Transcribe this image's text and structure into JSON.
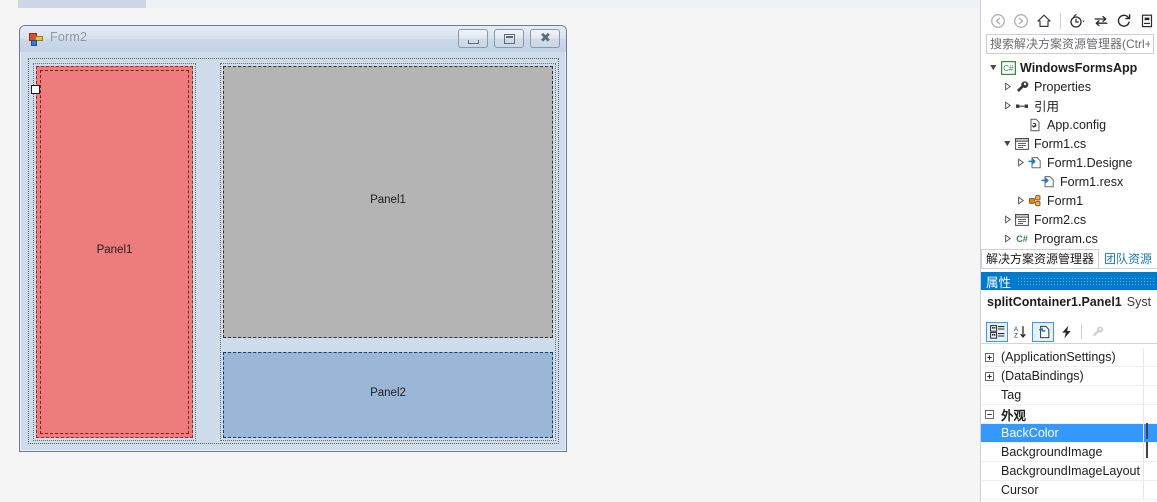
{
  "designer": {
    "form": {
      "title": "Form2",
      "icon": "form-icon",
      "window_buttons": [
        {
          "name": "minimize-button",
          "glyph": "minimize"
        },
        {
          "name": "maximize-button",
          "glyph": "maximize"
        },
        {
          "name": "close-button",
          "glyph": "close"
        }
      ]
    },
    "panels": [
      {
        "name": "panel-red",
        "label": "Panel1",
        "color": "#ee7c7c"
      },
      {
        "name": "panel-gray",
        "label": "Panel1",
        "color": "#b4b4b4"
      },
      {
        "name": "panel-blue",
        "label": "Panel2",
        "color": "#9bb7d8"
      }
    ]
  },
  "solution_explorer": {
    "toolbar": [
      {
        "name": "back-icon",
        "label": "Back"
      },
      {
        "name": "forward-icon",
        "label": "Forward"
      },
      {
        "name": "home-icon",
        "label": "Home"
      },
      {
        "name": "pending-changes-icon",
        "label": "Pending Changes"
      },
      {
        "name": "sync-with-active-document-icon",
        "label": "Sync with Active Document"
      },
      {
        "name": "refresh-icon",
        "label": "Refresh"
      },
      {
        "name": "collapse-all-icon",
        "label": "Collapse All"
      }
    ],
    "search": {
      "placeholder": "搜索解决方案资源管理器(Ctrl+;",
      "value": ""
    },
    "tree": [
      {
        "label": "WindowsFormsApp",
        "indent": 0,
        "expander": "down",
        "icon": "csharp-project-icon",
        "bold": true
      },
      {
        "label": "Properties",
        "indent": 1,
        "expander": "right",
        "icon": "properties-wrench-icon",
        "bold": false
      },
      {
        "label": "引用",
        "indent": 1,
        "expander": "right",
        "icon": "references-icon",
        "bold": false
      },
      {
        "label": "App.config",
        "indent": 2,
        "expander": "none",
        "icon": "config-file-icon",
        "bold": false
      },
      {
        "label": "Form1.cs",
        "indent": 1,
        "expander": "down",
        "icon": "form-file-icon",
        "bold": false
      },
      {
        "label": "Form1.Designe",
        "indent": 2,
        "expander": "right",
        "icon": "code-file-icon",
        "bold": false
      },
      {
        "label": "Form1.resx",
        "indent": 3,
        "expander": "none",
        "icon": "code-file-icon",
        "bold": false
      },
      {
        "label": "Form1",
        "indent": 2,
        "expander": "right",
        "icon": "class-icon",
        "bold": false
      },
      {
        "label": "Form2.cs",
        "indent": 1,
        "expander": "right",
        "icon": "form-file-icon",
        "bold": false
      },
      {
        "label": "Program.cs",
        "indent": 1,
        "expander": "right",
        "icon": "csharp-file-icon",
        "bold": false
      }
    ],
    "tabs": [
      {
        "label": "解决方案资源管理器",
        "active": true
      },
      {
        "label": "团队资源",
        "active": false
      }
    ]
  },
  "properties_window": {
    "title": "属性",
    "object_name": "splitContainer1.Panel1",
    "object_type": "Syst",
    "toolbar": [
      {
        "name": "categorized-button",
        "label": "Categorized",
        "state": "on"
      },
      {
        "name": "alphabetical-button",
        "label": "Alphabetical",
        "state": "off"
      },
      {
        "name": "properties-button",
        "label": "Properties",
        "state": "on"
      },
      {
        "name": "events-button",
        "label": "Events",
        "state": "off"
      },
      {
        "name": "property-pages-button",
        "label": "Property Pages",
        "state": "disabled"
      }
    ],
    "rows": [
      {
        "name": "(ApplicationSettings)",
        "expander": "plus",
        "kind": "group",
        "selected": false,
        "value_kind": "none"
      },
      {
        "name": "(DataBindings)",
        "expander": "plus",
        "kind": "group",
        "selected": false,
        "value_kind": "none"
      },
      {
        "name": "Tag",
        "expander": "none",
        "kind": "property",
        "selected": false,
        "value_kind": "none"
      },
      {
        "name": "外观",
        "expander": "minus",
        "kind": "category",
        "selected": false,
        "value_kind": "none"
      },
      {
        "name": "BackColor",
        "expander": "none",
        "kind": "property",
        "selected": true,
        "value_kind": "color",
        "value_color": "#ee7c7c"
      },
      {
        "name": "BackgroundImage",
        "expander": "none",
        "kind": "property",
        "selected": false,
        "value_kind": "box"
      },
      {
        "name": "BackgroundImageLayout",
        "expander": "none",
        "kind": "property",
        "selected": false,
        "value_kind": "none"
      },
      {
        "name": "Cursor",
        "expander": "none",
        "kind": "property",
        "selected": false,
        "value_kind": "none"
      }
    ]
  },
  "colors": {
    "accent": "#007acc",
    "selection": "#3399ff",
    "form_chrome": "#cfdcec",
    "red_panel": "#ee7c7c",
    "gray_panel": "#b4b4b4",
    "blue_panel": "#9bb7d8"
  }
}
